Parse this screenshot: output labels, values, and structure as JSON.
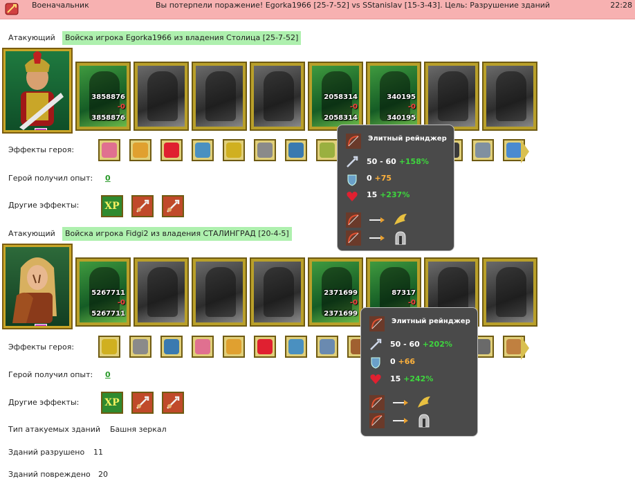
{
  "topbar": {
    "rank": "Военачальник",
    "message": "Вы потерпели поражение! Egorka1966 [25-7-52] vs SStanislav [15-3-43]. Цель: Разрушение зданий",
    "time": "22:28"
  },
  "armies": [
    {
      "role": "Атакующий",
      "title": "Войска игрока Egorka1966 из владения Столица [25-7-52]",
      "slots": [
        {
          "top": "3858876",
          "mid": "-0",
          "bottom": "3858876"
        },
        {
          "top": "",
          "mid": "",
          "bottom": ""
        },
        {
          "top": "",
          "mid": "",
          "bottom": ""
        },
        {
          "top": "",
          "mid": "",
          "bottom": ""
        },
        {
          "top": "2058314",
          "mid": "-0",
          "bottom": "2058314"
        },
        {
          "top": "340195",
          "mid": "-0",
          "bottom": "340195"
        },
        {
          "top": "",
          "mid": "",
          "bottom": ""
        },
        {
          "top": "",
          "mid": "",
          "bottom": ""
        }
      ],
      "effects_label": "Эффекты героя:",
      "xp_label": "Герой получил опыт:",
      "xp_value": "0",
      "other_label": "Другие эффекты:",
      "other_xp": "XP",
      "tooltip": {
        "title": "Элитный рейнджер",
        "attack": "50 - 60",
        "attack_bonus": "+158%",
        "defense": "0",
        "defense_bonus": "+75",
        "health": "15",
        "health_bonus": "+237%"
      }
    },
    {
      "role": "Атакующий",
      "title": "Войска игрока Fidgi2 из владения СТАЛИНГРАД [20-4-5]",
      "slots": [
        {
          "top": "5267711",
          "mid": "-0",
          "bottom": "5267711"
        },
        {
          "top": "",
          "mid": "",
          "bottom": ""
        },
        {
          "top": "",
          "mid": "",
          "bottom": ""
        },
        {
          "top": "",
          "mid": "",
          "bottom": ""
        },
        {
          "top": "2371699",
          "mid": "-0",
          "bottom": "2371699"
        },
        {
          "top": "87317",
          "mid": "-0",
          "bottom": ""
        },
        {
          "top": "",
          "mid": "",
          "bottom": ""
        },
        {
          "top": "",
          "mid": "",
          "bottom": ""
        }
      ],
      "effects_label": "Эффекты героя:",
      "xp_label": "Герой получил опыт:",
      "xp_value": "0",
      "other_label": "Другие эффекты:",
      "other_xp": "XP",
      "tooltip": {
        "title": "Элитный рейнджер",
        "attack": "50 - 60",
        "attack_bonus": "+202%",
        "defense": "0",
        "defense_bonus": "+66",
        "health": "15",
        "health_bonus": "+242%"
      }
    }
  ],
  "summary": {
    "target_label": "Тип атакуемых зданий",
    "target_value": "Башня зеркал",
    "destroyed_label": "Зданий разрушено",
    "destroyed_value": "11",
    "damaged_label": "Зданий повреждено",
    "damaged_value": "20"
  },
  "colors": {
    "topbar": "#f7b1b1",
    "army_title_bg": "#aef0ae",
    "xp_link": "#2a9a2a",
    "bonus_green": "#3ed63e",
    "bonus_orange": "#ffb23c"
  }
}
